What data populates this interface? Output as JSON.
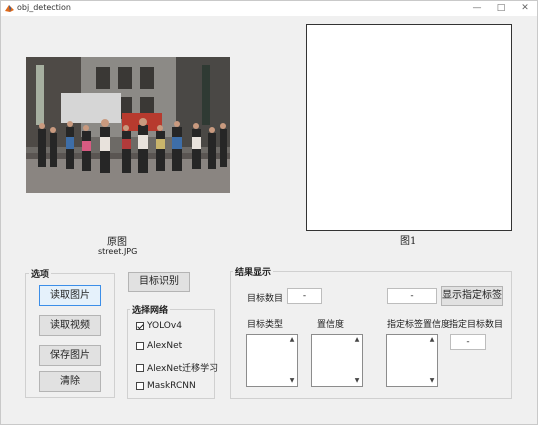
{
  "window": {
    "title": "obj_detection"
  },
  "images": {
    "original_caption": "原图",
    "original_filename": "street.JPG",
    "result_caption": "图1"
  },
  "options_panel": {
    "title": "选项",
    "read_image": "读取图片",
    "read_video": "读取视频",
    "save_image": "保存图片",
    "clear": "清除"
  },
  "detect_button": "目标识别",
  "network_panel": {
    "title": "选择网络",
    "options": [
      "YOLOv4",
      "AlexNet",
      "AlexNet迁移学习",
      "MaskRCNN"
    ],
    "checked": [
      true,
      false,
      false,
      false
    ]
  },
  "results_panel": {
    "title": "结果显示",
    "target_count_label": "目标数目",
    "target_count_value": "-",
    "specified_label_value": "-",
    "show_label_button": "显示指定标签",
    "target_type_label": "目标类型",
    "confidence_label": "置信度",
    "label_confidence_label": "指定标签置信度",
    "specified_count_label": "指定目标数目",
    "specified_count_value": "-"
  }
}
